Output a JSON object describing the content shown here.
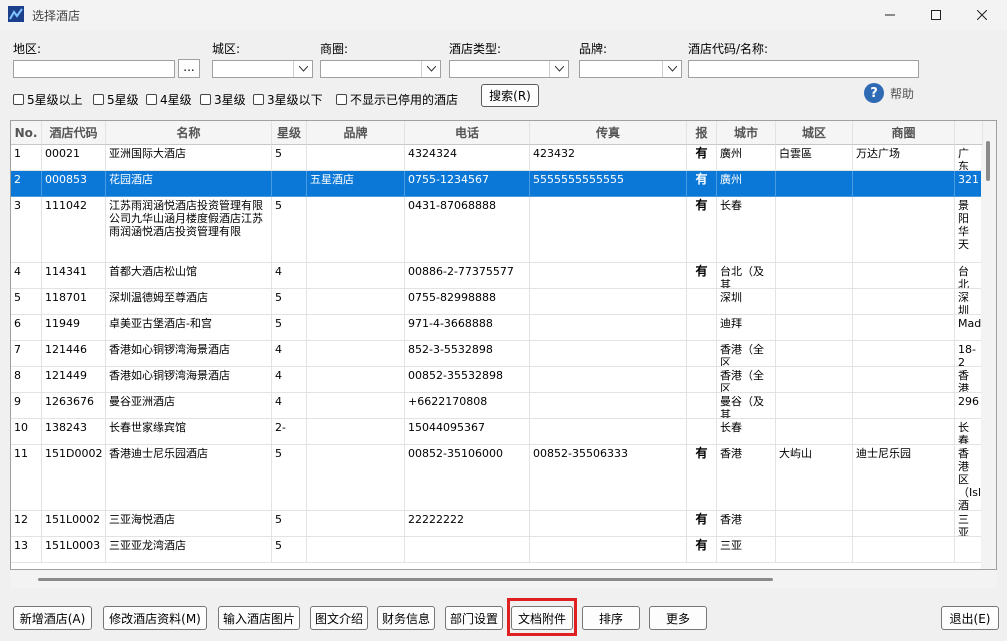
{
  "window": {
    "title": "选择酒店"
  },
  "filters": {
    "region_label": "地区:",
    "district_label": "城区:",
    "business_area_label": "商圈:",
    "hotel_type_label": "酒店类型:",
    "brand_label": "品牌:",
    "code_name_label": "酒店代码/名称:",
    "browse_label": "...",
    "checkboxes": [
      "5星级以上",
      "5星级",
      "4星级",
      "3星级",
      "3星级以下",
      "不显示已停用的酒店"
    ],
    "search_label": "搜索(R)",
    "help_label": "帮助"
  },
  "table": {
    "columns": [
      "No.",
      "酒店代码",
      "名称",
      "星级",
      "品牌",
      "电话",
      "传真",
      "报价",
      "城市",
      "城区",
      "商圈",
      ""
    ],
    "rows": [
      [
        "1",
        "00021",
        "亚洲国际大酒店",
        "5",
        "",
        "4324324",
        "423432",
        "有",
        "廣州",
        "白雲區",
        "万达广场",
        "广东"
      ],
      [
        "2",
        "000853",
        "花园酒店",
        "",
        "五星酒店",
        "0755-1234567",
        "5555555555555",
        "有",
        "廣州",
        "",
        "",
        "321"
      ],
      [
        "3",
        "111042",
        "江苏雨润涵悦酒店投资管理有限公司九华山涵月楼度假酒店江苏雨润涵悦酒店投资管理有限",
        "5",
        "",
        "0431-87068888",
        "",
        "有",
        "长春",
        "",
        "",
        "景阳华天"
      ],
      [
        "4",
        "114341",
        "首都大酒店松山馆",
        "4",
        "",
        "00886-2-77375577",
        "",
        "有",
        "台北（及其",
        "",
        "",
        "台北"
      ],
      [
        "5",
        "118701",
        "深圳温德姆至尊酒店",
        "5",
        "",
        "0755-82998888",
        "",
        "",
        "深圳",
        "",
        "",
        "深圳"
      ],
      [
        "6",
        "11949",
        "卓美亚古堡酒店-和宫",
        "5",
        "",
        "971-4-3668888",
        "",
        "",
        "迪拜",
        "",
        "",
        "Madi"
      ],
      [
        "7",
        "121446",
        "香港如心铜锣湾海景酒店",
        "4",
        "",
        "852-3-5532898",
        "",
        "",
        "香港（全区",
        "",
        "",
        "18-2"
      ],
      [
        "8",
        "121449",
        "香港如心铜锣湾海景酒店",
        "4",
        "",
        "00852-35532898",
        "",
        "",
        "香港（全区",
        "",
        "",
        "香港"
      ],
      [
        "9",
        "1263676",
        "曼谷亚洲酒店",
        "4",
        "",
        "+6622170808",
        "",
        "",
        "曼谷（及其",
        "",
        "",
        "296"
      ],
      [
        "10",
        "138243",
        "长春世家缘宾馆",
        "2-",
        "",
        "15044095367",
        "",
        "",
        "长春",
        "",
        "",
        "长春"
      ],
      [
        "11",
        "151D0002",
        "香港迪士尼乐园酒店",
        "5",
        "",
        "00852-35106000",
        "00852-35506333",
        "有",
        "香港",
        "大屿山",
        "迪士尼乐园",
        "香港区（Isle酒店"
      ],
      [
        "12",
        "151L0002",
        "三亚海悦酒店",
        "5",
        "",
        "22222222",
        "",
        "有",
        "香港",
        "",
        "",
        "三亚"
      ],
      [
        "13",
        "151L0003",
        "三亚亚龙湾酒店",
        "5",
        "",
        "",
        "",
        "有",
        "三亚",
        "",
        "",
        ""
      ]
    ]
  },
  "buttons": [
    "新增酒店(A)",
    "修改酒店资料(M)",
    "输入酒店图片",
    "图文介绍",
    "财务信息",
    "部门设置",
    "文档附件",
    "排序",
    "更多",
    "退出(E)"
  ]
}
